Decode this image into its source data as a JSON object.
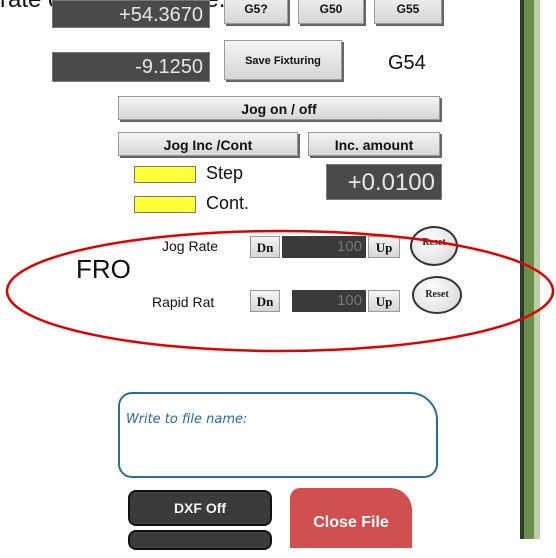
{
  "doc": {
    "top_text": "rate of your machine."
  },
  "dro": {
    "top_value": "+54.3670",
    "bottom_value": "-9.1250"
  },
  "fixtures": {
    "buttons": [
      "G5?",
      "G50",
      "G55"
    ],
    "save_label": "Save Fixturing",
    "current": "G54"
  },
  "jog": {
    "toggle_label": "Jog on / off",
    "inc_cont_label": "Jog Inc /Cont",
    "inc_amount_label": "Inc. amount",
    "step_label": "Step",
    "cont_label": "Cont.",
    "inc_value": "+0.0100"
  },
  "fro": {
    "label": "FRO",
    "rows": [
      {
        "name": "Jog Rate",
        "dn": "Dn",
        "value": "100",
        "up": "Up",
        "reset": "Reset"
      },
      {
        "name": "Rapid Rat",
        "dn": "Dn",
        "value": "100",
        "up": "Up",
        "reset": "Reset"
      }
    ]
  },
  "file": {
    "write_label": "Write to file name:",
    "dxf_label": "DXF Off",
    "close_label": "Close File"
  },
  "colors": {
    "highlight_ellipse": "#e00000",
    "swatch_yellow": "#ffff3a",
    "close_red": "#d05050"
  }
}
